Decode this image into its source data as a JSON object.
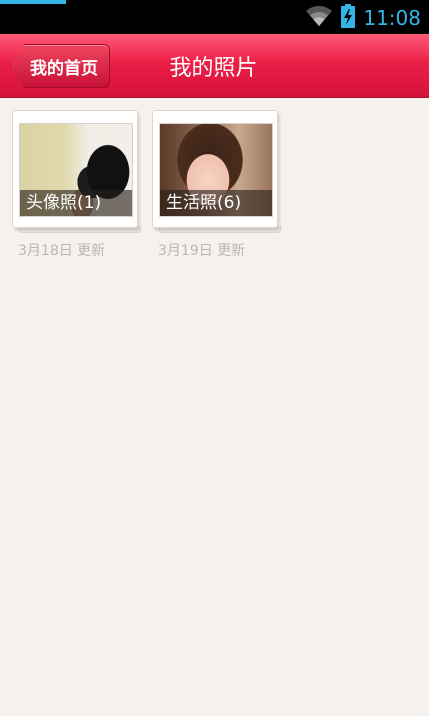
{
  "status_bar": {
    "time": "11:08",
    "icons": [
      "wifi-icon",
      "battery-charging-icon"
    ],
    "accent_color": "#33b5e5"
  },
  "header": {
    "back_label": "我的首页",
    "title": "我的照片",
    "color": "#ec1f47"
  },
  "albums": [
    {
      "caption": "头像照(1)",
      "date": "3月18日 更新"
    },
    {
      "caption": "生活照(6)",
      "date": "3月19日 更新"
    }
  ]
}
